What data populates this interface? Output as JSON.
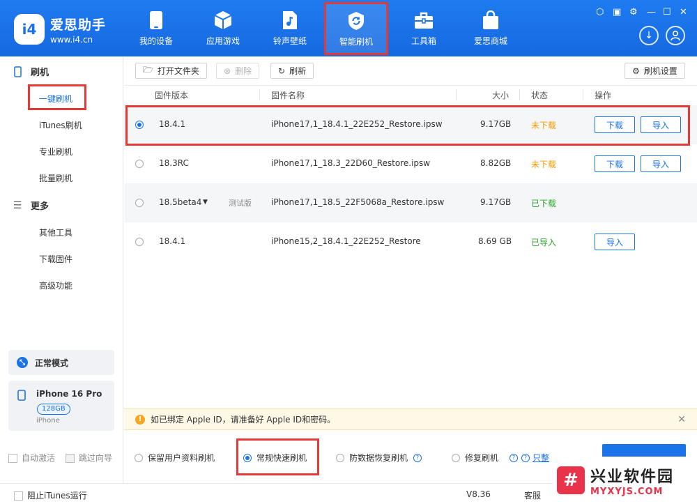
{
  "app": {
    "logo_mark": "i4",
    "name": "爱思助手",
    "url": "www.i4.cn"
  },
  "nav": [
    {
      "label": "我的设备",
      "icon": "phone-icon"
    },
    {
      "label": "应用游戏",
      "icon": "cube-icon"
    },
    {
      "label": "铃声壁纸",
      "icon": "music-file-icon"
    },
    {
      "label": "智能刷机",
      "icon": "refresh-shield-icon",
      "active": true
    },
    {
      "label": "工具箱",
      "icon": "toolbox-icon"
    },
    {
      "label": "爱思商城",
      "icon": "shopping-bag-icon"
    }
  ],
  "sidebar": {
    "flash_header": "刷机",
    "flash_items": [
      "一键刷机",
      "iTunes刷机",
      "专业刷机",
      "批量刷机"
    ],
    "more_header": "更多",
    "more_items": [
      "其他工具",
      "下载固件",
      "高级功能"
    ],
    "mode": "正常模式",
    "device_name": "iPhone 16 Pro",
    "device_storage": "128GB",
    "device_type": "iPhone",
    "auto_activate": "自动激活",
    "skip_guide": "跳过向导"
  },
  "toolbar": {
    "open_folder": "打开文件夹",
    "delete": "删除",
    "refresh": "刷新",
    "settings": "刷机设置"
  },
  "table": {
    "headers": [
      "固件版本",
      "固件名称",
      "大小",
      "状态",
      "操作"
    ],
    "rows": [
      {
        "version": "18.4.1",
        "tag": "",
        "name": "iPhone17,1_18.4.1_22E252_Restore.ipsw",
        "size": "9.17GB",
        "status": "未下载",
        "download": "下载",
        "import": "导入"
      },
      {
        "version": "18.3RC",
        "tag": "",
        "name": "iPhone17,1_18.3_22D60_Restore.ipsw",
        "size": "8.82GB",
        "status": "未下载",
        "download": "下载",
        "import": "导入"
      },
      {
        "version": "18.5beta4",
        "tag": "测试版",
        "name": "iPhone17,1_18.5_22F5068a_Restore.ipsw",
        "size": "9.17GB",
        "status": "已下载"
      },
      {
        "version": "18.4.1",
        "tag": "",
        "name": "iPhone15,2_18.4.1_22E252_Restore",
        "size": "8.69 GB",
        "status": "已导入",
        "import": "导入"
      }
    ]
  },
  "notice": "如已绑定 Apple ID，请准备好 Apple ID和密码。",
  "options": {
    "keep_data": "保留用户资料刷机",
    "quick": "常规快速刷机",
    "anti_recovery": "防数据恢复刷机",
    "repair": "修复刷机",
    "link_partial": "只整"
  },
  "status": {
    "block_itunes": "阻止iTunes运行",
    "version": "V8.36",
    "service": "客服"
  },
  "watermark": {
    "mark": "#",
    "cn": "兴业软件园",
    "en": "MYXYJS.COM"
  },
  "colors": {
    "brand": "#1a73e8",
    "highlight": "#e53935",
    "pending": "#f59a00",
    "done": "#2aa52a"
  }
}
